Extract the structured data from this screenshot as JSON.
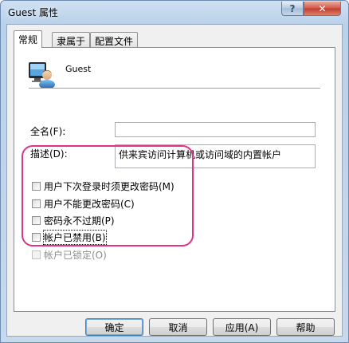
{
  "window": {
    "title": "Guest 属性",
    "help_glyph": "?",
    "close_glyph": "✕"
  },
  "tabs": [
    {
      "label": "常规",
      "active": true
    },
    {
      "label": "隶属于",
      "active": false
    },
    {
      "label": "配置文件",
      "active": false
    }
  ],
  "user": {
    "name": "Guest",
    "icon": "user-account-icon"
  },
  "fields": {
    "fullname_label": "全名(F):",
    "fullname_value": "",
    "description_label": "描述(D):",
    "description_value": "供来宾访问计算机或访问域的内置帐户"
  },
  "checkboxes": [
    {
      "label": "用户下次登录时须更改密码(M)",
      "checked": false,
      "disabled": false
    },
    {
      "label": "用户不能更改密码(C)",
      "checked": false,
      "disabled": false
    },
    {
      "label": "密码永不过期(P)",
      "checked": false,
      "disabled": false
    },
    {
      "label": "帐户已禁用(B)",
      "checked": false,
      "disabled": false
    },
    {
      "label": "帐户已锁定(O)",
      "checked": false,
      "disabled": true
    }
  ],
  "buttons": {
    "ok": "确定",
    "cancel": "取消",
    "apply": "应用(A)",
    "help": "帮助"
  },
  "colors": {
    "highlight": "#e0338a",
    "close_button": "#c53a2c"
  }
}
